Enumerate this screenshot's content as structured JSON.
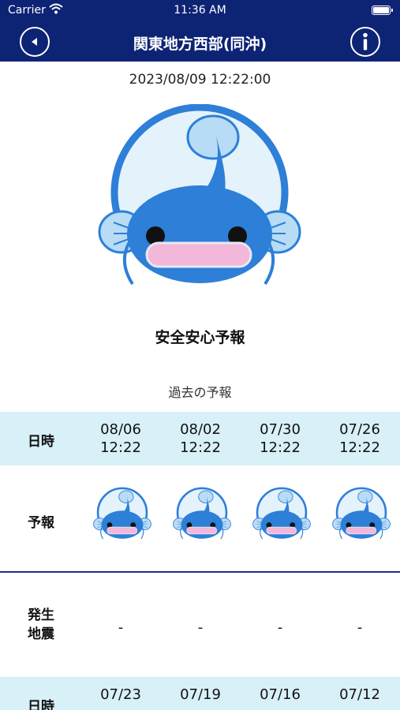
{
  "status_bar": {
    "carrier": "Carrier",
    "time": "11:36 AM"
  },
  "nav": {
    "title": "関東地方西部(同沖)",
    "back_icon": "back-arrow-icon",
    "info_icon": "info-icon"
  },
  "current": {
    "datetime": "2023/08/09 12:22:00",
    "label": "安全安心予報",
    "mascot": "catfish-safe-icon"
  },
  "past": {
    "title": "過去の予報",
    "row_labels": {
      "datetime": "日時",
      "forecast": "予報",
      "earthquake": "発生\n地震"
    },
    "groups": [
      {
        "entries": [
          {
            "date": "08/06",
            "time": "12:22",
            "earthquake": "-"
          },
          {
            "date": "08/02",
            "time": "12:22",
            "earthquake": "-"
          },
          {
            "date": "07/30",
            "time": "12:22",
            "earthquake": "-"
          },
          {
            "date": "07/26",
            "time": "12:22",
            "earthquake": "-"
          }
        ]
      },
      {
        "entries": [
          {
            "date": "07/23"
          },
          {
            "date": "07/19"
          },
          {
            "date": "07/16"
          },
          {
            "date": "07/12"
          }
        ]
      }
    ]
  },
  "colors": {
    "nav": "#0d2374",
    "row_highlight": "#d8f0f7",
    "mascot_blue": "#2d7fd8",
    "divider": "#1c2f86"
  }
}
